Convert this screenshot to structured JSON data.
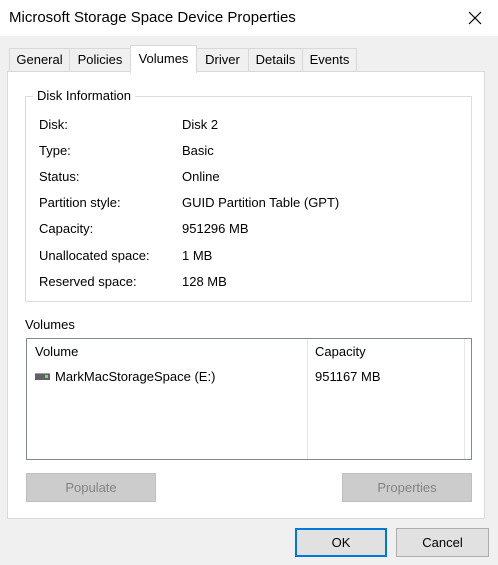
{
  "window": {
    "title": "Microsoft Storage Space Device Properties",
    "close_glyph": "✕"
  },
  "tabs": [
    {
      "label": "General"
    },
    {
      "label": "Policies"
    },
    {
      "label": "Volumes",
      "selected": true
    },
    {
      "label": "Driver"
    },
    {
      "label": "Details"
    },
    {
      "label": "Events"
    }
  ],
  "disk_info": {
    "legend": "Disk Information",
    "rows": [
      {
        "label": "Disk:",
        "value": "Disk 2"
      },
      {
        "label": "Type:",
        "value": "Basic"
      },
      {
        "label": "Status:",
        "value": "Online"
      },
      {
        "label": "Partition style:",
        "value": "GUID Partition Table (GPT)"
      },
      {
        "label": "Capacity:",
        "value": "951296 MB"
      },
      {
        "label": "Unallocated space:",
        "value": "1 MB"
      },
      {
        "label": "Reserved space:",
        "value": "128 MB"
      }
    ]
  },
  "volumes": {
    "title": "Volumes",
    "columns": [
      "Volume",
      "Capacity"
    ],
    "rows": [
      {
        "icon": "drive-icon",
        "volume": "MarkMacStorageSpace (E:)",
        "capacity": "951167 MB"
      }
    ],
    "populate_label": "Populate",
    "properties_label": "Properties"
  },
  "footer": {
    "ok_label": "OK",
    "cancel_label": "Cancel"
  },
  "colors": {
    "accent": "#0078d7",
    "panel": "#ffffff",
    "dialog_bg": "#f0f0f0"
  }
}
